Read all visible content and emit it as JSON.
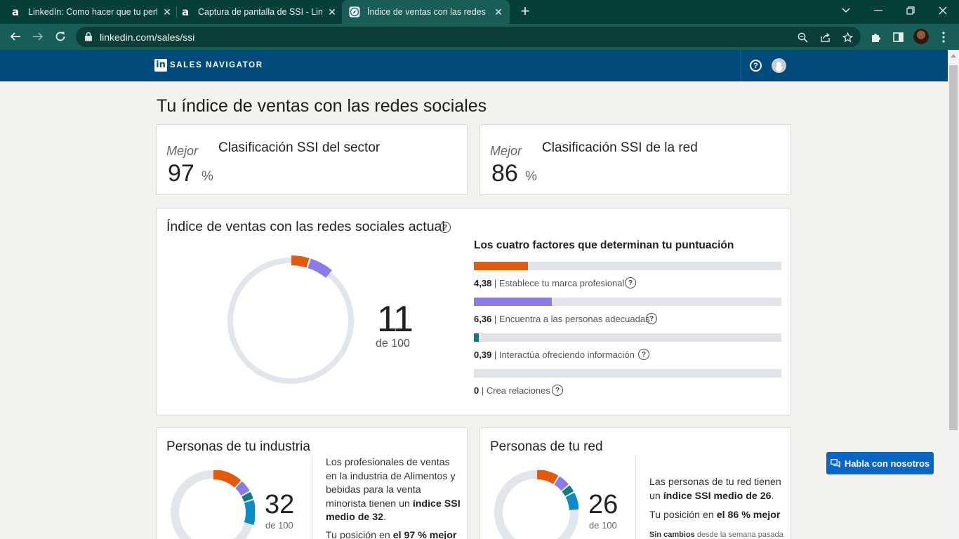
{
  "browser": {
    "tabs": [
      {
        "title": "LinkedIn: Como hacer que tu perfil",
        "favicon": "a"
      },
      {
        "title": "Captura de pantalla de SSI - Linked",
        "favicon": "a"
      },
      {
        "title": "Índice de ventas con las redes so",
        "favicon": "compass"
      }
    ],
    "url": "linkedin.com/sales/ssi"
  },
  "header": {
    "brand": "SALES NAVIGATOR",
    "logo": "in"
  },
  "page_title": "Tu índice de ventas con las redes sociales",
  "rankings": [
    {
      "mejor": "Mejor",
      "title": "Clasificación SSI del sector",
      "value": "97",
      "unit": "%"
    },
    {
      "mejor": "Mejor",
      "title": "Clasificación SSI de la red",
      "value": "86",
      "unit": "%"
    }
  ],
  "ssi": {
    "title": "Índice de ventas con las redes sociales actual",
    "score": "11",
    "of_label": "de 100",
    "factors_title": "Los cuatro factores que determinan tu puntuación",
    "factors": [
      {
        "value": "4,38",
        "label": "Establece tu marca profesional",
        "fraction": 0.175,
        "color": "#e35a0d"
      },
      {
        "value": "6,36",
        "label": "Encuentra a las personas adecuadas",
        "fraction": 0.254,
        "color": "#8b7be8"
      },
      {
        "value": "0,39",
        "label": "Interactúa ofreciendo información",
        "fraction": 0.016,
        "color": "#127a7e"
      },
      {
        "value": "0",
        "label": "Crea relaciones",
        "fraction": 0,
        "color": "#0e8ac8"
      }
    ]
  },
  "industry": {
    "title": "Personas de tu industria",
    "score": "32",
    "of_label": "de 100",
    "text_1": "Los profesionales de ventas en la industria de Alimentos y bebidas para la venta minorista tienen un",
    "text_bold": "índice SSI medio de 32",
    "text_end": ".",
    "position_pre": "Tu posición en",
    "position_bold": "el 97 % mejor"
  },
  "network": {
    "title": "Personas de tu red",
    "score": "26",
    "of_label": "de 100",
    "text_1": "Las personas de tu red tienen un",
    "text_bold": "índice SSI medio de 26",
    "text_end": ".",
    "position_pre": "Tu posición en",
    "position_bold": "el 86 % mejor",
    "note_bold": "Sin cambios",
    "note_rest": "desde la semana pasada"
  },
  "chat_button": "Habla con nosotros"
}
